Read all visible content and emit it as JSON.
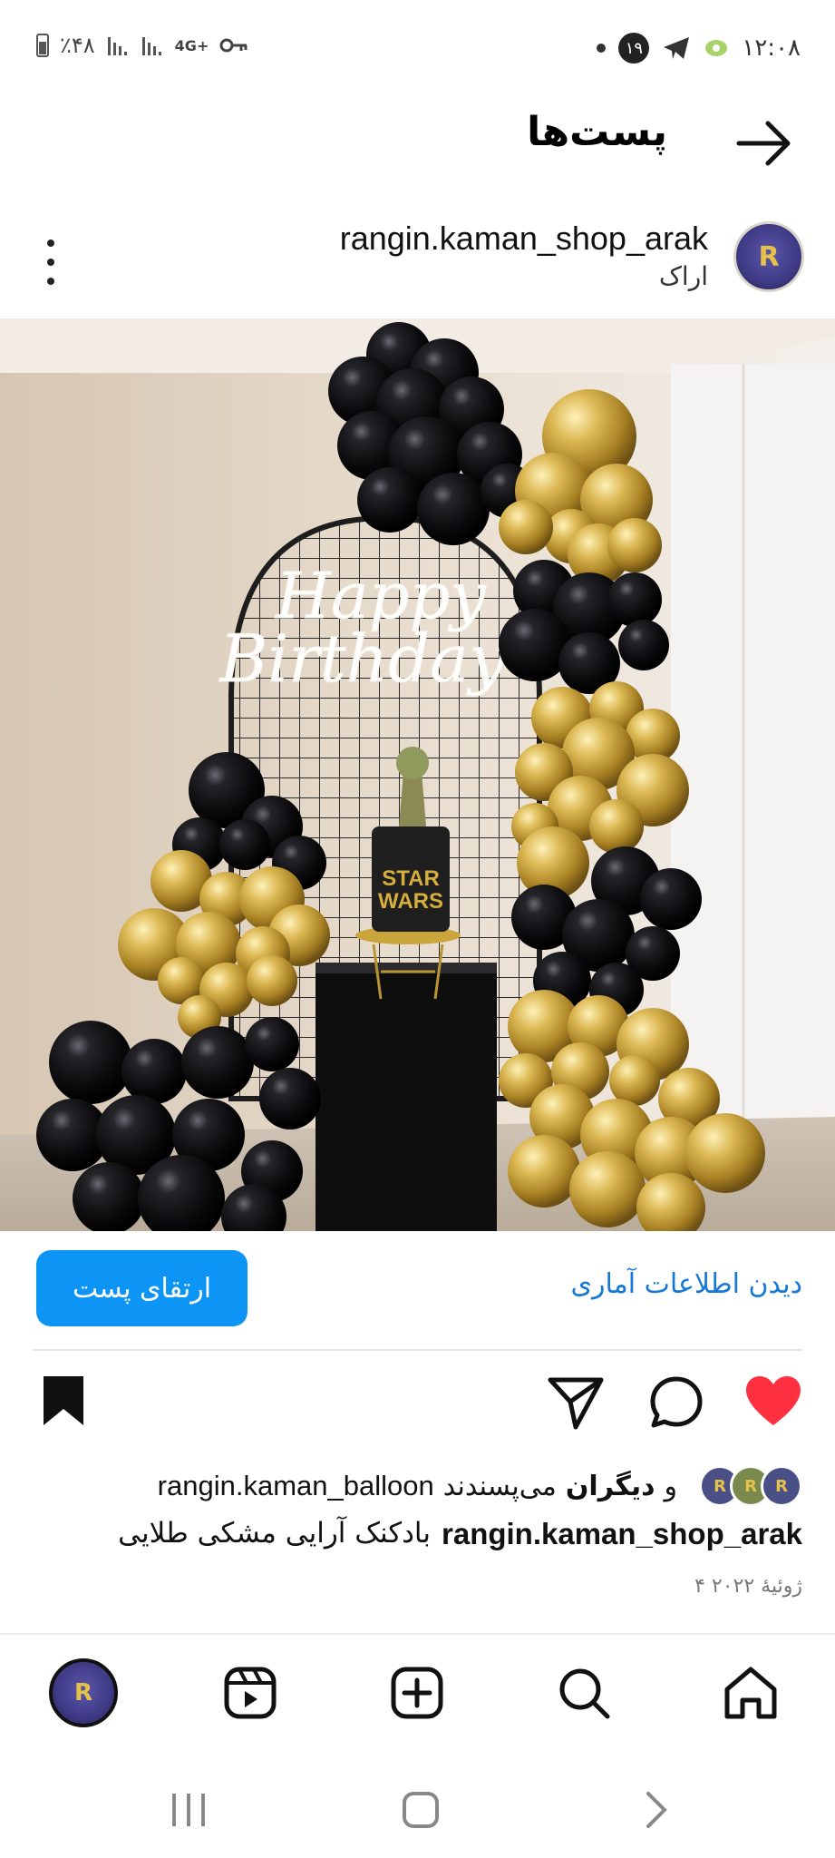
{
  "status_bar": {
    "time": "۱۲:۰۸",
    "battery": "٪۴۸",
    "network": "4G+",
    "notification_count": "۱۹",
    "icons": [
      "battery-icon",
      "signal-icon",
      "signal-icon",
      "network-4g-icon",
      "vpn-key-icon",
      "dot-icon",
      "notification-badge-icon",
      "telegram-icon",
      "app-icon"
    ]
  },
  "header": {
    "title": "پست‌ها",
    "back_icon": "arrow-right-icon"
  },
  "post": {
    "username": "rangin.kaman_shop_arak",
    "location": "اراک",
    "avatar_initial": "R",
    "image_alt": "balloon-arch-photo",
    "neon_text_line1": "Happy",
    "neon_text_line2": "Birthday",
    "cake_text_line1": "STAR",
    "cake_text_line2": "WARS"
  },
  "promo": {
    "boost_label": "ارتقای پست",
    "insights_label": "دیدن اطلاعات آماری"
  },
  "engagement": {
    "liked_by_user": "rangin.kaman_balloon",
    "liked_suffix": "می‌پسندند",
    "and_word": "و",
    "others_word": "دیگران"
  },
  "caption": {
    "username": "rangin.kaman_shop_arak",
    "text": "بادکنک آرایی مشکی طلایی"
  },
  "date": "۴ ژوئیهٔ ۲۰۲۲",
  "colors": {
    "accent_blue": "#0d95f6",
    "link_blue": "#1678d6",
    "like_red": "#ff3040",
    "balloon_black": "#0b0b0d",
    "balloon_gold": "#c9a53c"
  },
  "bottom_nav": {
    "items": [
      "home-icon",
      "search-icon",
      "create-icon",
      "reels-icon",
      "profile-avatar"
    ]
  },
  "system_nav": {
    "items": [
      "recent-apps-icon",
      "home-button-icon",
      "back-chevron-icon"
    ]
  }
}
